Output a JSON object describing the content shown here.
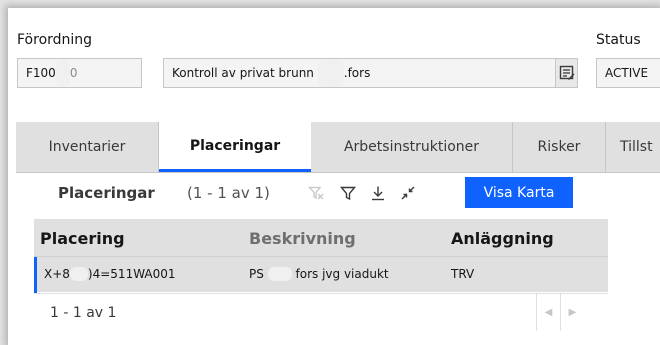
{
  "header": {
    "forordning_label": "Förordning",
    "forordning_value": "F100",
    "forordning_value_tail": "0",
    "description_value": "Kontroll av privat brunn",
    "description_tail": ".fors",
    "status_label": "Status",
    "status_value": "ACTIVE"
  },
  "tabs": [
    {
      "label": "Inventarier",
      "active": false
    },
    {
      "label": "Placeringar",
      "active": true
    },
    {
      "label": "Arbetsinstruktioner",
      "active": false
    },
    {
      "label": "Risker",
      "active": false
    },
    {
      "label": "Tillst",
      "active": false
    }
  ],
  "section": {
    "title": "Placeringar",
    "count": "(1 - 1 av 1)",
    "map_button": "Visa Karta",
    "icons": [
      "clear-filter-icon",
      "filter-icon",
      "download-icon",
      "collapse-icon"
    ]
  },
  "table": {
    "columns": [
      "Placering",
      "Beskrivning",
      "Anläggning"
    ],
    "rows": [
      {
        "placering_a": "X+8",
        "placering_b": ")4=511WA001",
        "beskrivning_a": "PS",
        "beskrivning_b": "fors jvg viadukt",
        "anlaggning": "TRV"
      }
    ]
  },
  "footer": {
    "pager_text": "1 - 1 av 1"
  },
  "colors": {
    "accent": "#0f62fe",
    "tab_bg": "#e0e0e0",
    "field_bg": "#f4f4f4"
  }
}
